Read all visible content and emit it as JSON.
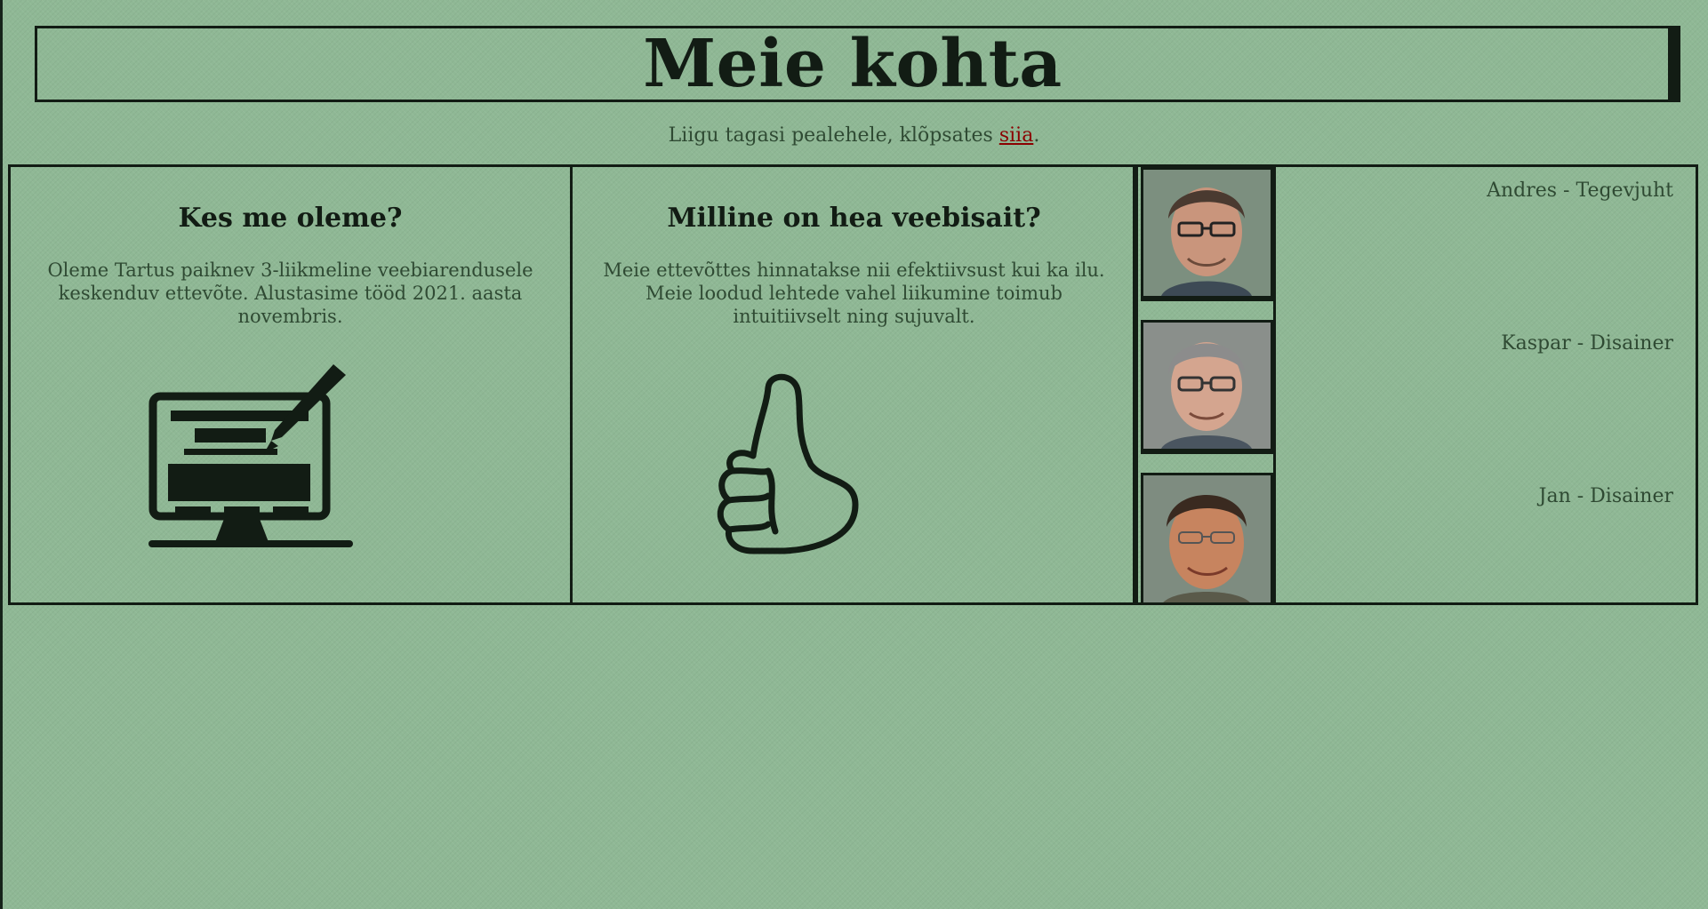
{
  "page": {
    "title": "Meie kohta",
    "back_text_prefix": "Liigu tagasi pealehele, klõpsates ",
    "back_link_label": "siia",
    "back_text_suffix": "."
  },
  "columns": [
    {
      "heading": "Kes me oleme?",
      "text": "Oleme Tartus paiknev 3-liikmeline veebiarendusele keskenduv ettevõte. Alustasime tööd 2021. aasta novembris.",
      "icon": "computer-pen-icon"
    },
    {
      "heading": "Milline on hea veebisait?",
      "text": "Meie ettevõttes hinnatakse nii efektiivsust kui ka ilu. Meie loodud lehtede vahel liikumine toimub intuitiivselt ning sujuvalt.",
      "icon": "thumbs-up-icon"
    }
  ],
  "team": [
    {
      "name": "Andres - Tegevjuht"
    },
    {
      "name": "Kaspar - Disainer"
    },
    {
      "name": "Jan - Disainer"
    }
  ],
  "colors": {
    "background": "#8fb895",
    "border": "#121c14",
    "text": "#2f4a33",
    "link": "#8b0000"
  }
}
